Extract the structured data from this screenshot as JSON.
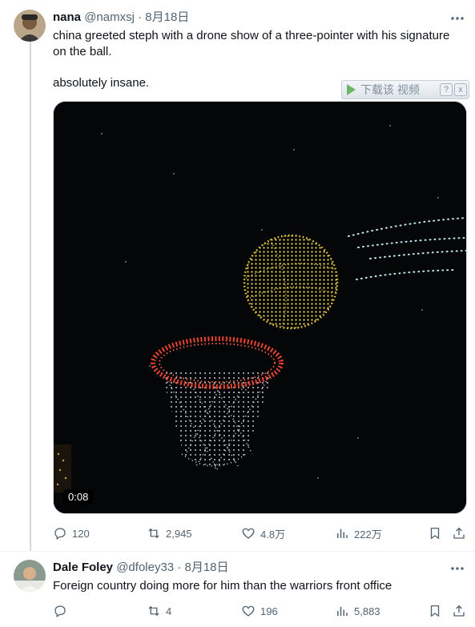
{
  "tweets": [
    {
      "name": "nana",
      "handle": "@namxsj",
      "dot": "·",
      "date": "8月18日",
      "text": "china greeted steph with a drone show of a three-pointer with his signature on the ball.",
      "text2": "absolutely insane.",
      "video_time": "0:08",
      "stats": {
        "replies": "120",
        "retweets": "2,945",
        "likes": "4.8万",
        "views": "222万"
      }
    },
    {
      "name": "Dale Foley",
      "handle": "@dfoley33",
      "dot": "·",
      "date": "8月18日",
      "text": "Foreign country doing more for him than the warriors front office",
      "stats": {
        "replies": "",
        "retweets": "4",
        "likes": "196",
        "views": "5,883"
      }
    }
  ],
  "download_bar": {
    "label": "下载该 视频",
    "help": "?",
    "close": "x"
  },
  "colors": {
    "text": "#0f1419",
    "secondary": "#536471",
    "thread_line": "#cfd9de",
    "hoop_red": "#e8412f",
    "ball_yellow": "#f4d23c",
    "net_white": "#cfe8ee"
  },
  "icons": [
    "more-icon",
    "reply-icon",
    "retweet-icon",
    "like-icon",
    "views-icon",
    "bookmark-icon",
    "share-icon"
  ]
}
